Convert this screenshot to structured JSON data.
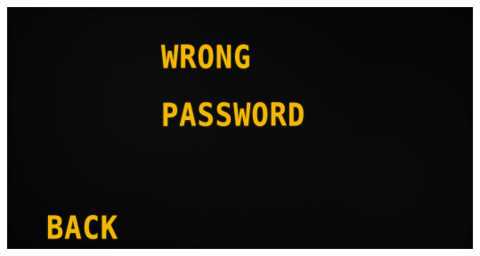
{
  "message": {
    "line1": "WRONG",
    "line2": "PASSWORD"
  },
  "navigation": {
    "back_label": "BACK"
  },
  "colors": {
    "display_background": "#040404",
    "text": "#f2b705",
    "frame": "#ffffff"
  }
}
